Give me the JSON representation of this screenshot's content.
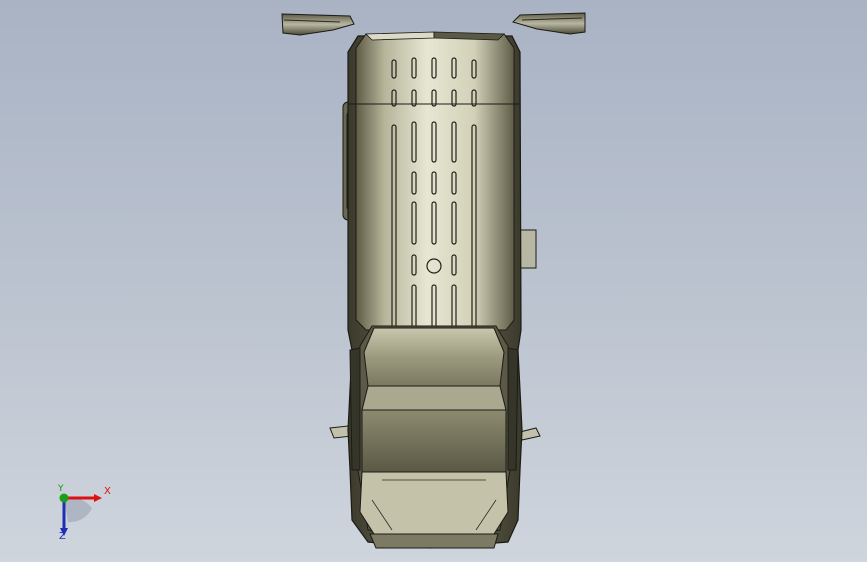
{
  "viewport": {
    "background_top": "#a9b3c4",
    "background_bottom": "#cfd5dd"
  },
  "model": {
    "description_icon": "van-top-view",
    "body_color": "#6d6b52",
    "outline_color": "#1b1b16"
  },
  "triad": {
    "x_label": "X",
    "y_label": "Y",
    "z_label": "Z",
    "x_color": "#dd1111",
    "y_color": "#1a9f1a",
    "z_color": "#1f2fb5"
  }
}
